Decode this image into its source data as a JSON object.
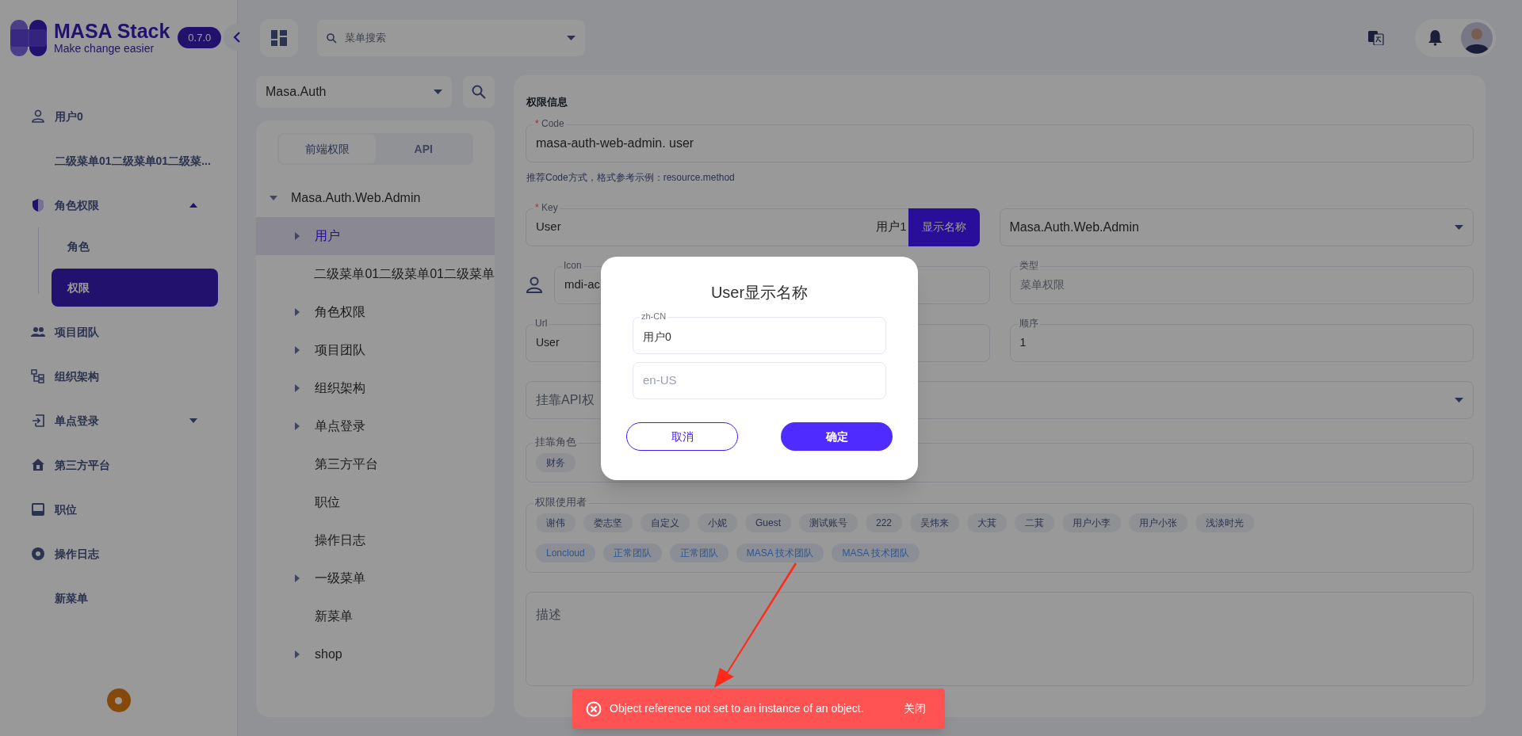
{
  "app": {
    "title": "MASA Stack",
    "subtitle": "Make change easier",
    "version": "0.7.0"
  },
  "sidebar": {
    "items": [
      {
        "label": "用户0",
        "kind": "link",
        "selected": false
      },
      {
        "label": "二级菜单01二级菜单01二级菜...",
        "kind": "link",
        "selected": false
      },
      {
        "label": "角色权限",
        "kind": "group",
        "expanded": true,
        "selected": false,
        "children": [
          {
            "label": "角色",
            "selected": false
          },
          {
            "label": "权限",
            "selected": true
          }
        ]
      },
      {
        "label": "项目团队",
        "kind": "link",
        "selected": false
      },
      {
        "label": "组织架构",
        "kind": "link",
        "selected": false
      },
      {
        "label": "单点登录",
        "kind": "group",
        "expanded": false,
        "selected": false
      },
      {
        "label": "第三方平台",
        "kind": "link",
        "selected": false
      },
      {
        "label": "职位",
        "kind": "link",
        "selected": false
      },
      {
        "label": "操作日志",
        "kind": "link",
        "selected": false
      },
      {
        "label": "新菜单",
        "kind": "link",
        "selected": false
      }
    ]
  },
  "header": {
    "search_placeholder": "菜单搜索"
  },
  "tree": {
    "app_select": "Masa.Auth",
    "tabs": [
      {
        "label": "前端权限",
        "selected": true
      },
      {
        "label": "API",
        "selected": false
      }
    ],
    "items": [
      {
        "label": "Masa.Auth.Web.Admin",
        "kind": "branch",
        "expanded": true,
        "selected": false,
        "children": [
          {
            "label": "用户",
            "kind": "branch",
            "expanded": false,
            "selected": true
          },
          {
            "label": "二级菜单01二级菜单01二级菜单",
            "kind": "leaf",
            "selected": false
          },
          {
            "label": "角色权限",
            "kind": "branch",
            "expanded": false,
            "selected": false
          },
          {
            "label": "项目团队",
            "kind": "branch",
            "expanded": false,
            "selected": false
          },
          {
            "label": "组织架构",
            "kind": "branch",
            "expanded": false,
            "selected": false
          },
          {
            "label": "单点登录",
            "kind": "branch",
            "expanded": false,
            "selected": false
          },
          {
            "label": "第三方平台",
            "kind": "leaf",
            "selected": false
          },
          {
            "label": "职位",
            "kind": "leaf",
            "selected": false
          },
          {
            "label": "操作日志",
            "kind": "leaf",
            "selected": false
          },
          {
            "label": "一级菜单",
            "kind": "branch",
            "expanded": false,
            "selected": false
          },
          {
            "label": "新菜单",
            "kind": "leaf",
            "selected": false
          },
          {
            "label": "shop",
            "kind": "branch",
            "expanded": false,
            "selected": false
          }
        ]
      }
    ]
  },
  "form": {
    "title": "权限信息",
    "code": {
      "required_mark": "*",
      "label": "Code",
      "value": "masa-auth-web-admin. user"
    },
    "code_hint": "推荐Code方式，格式参考示例：resource.method",
    "key": {
      "required_mark": "*",
      "label": "Key",
      "value": "User",
      "display_name": "用户1",
      "button": "显示名称"
    },
    "app_select": {
      "value": "Masa.Auth.Web.Admin"
    },
    "icon": {
      "label": "Icon",
      "value": "mdi-ac"
    },
    "type": {
      "label": "类型",
      "value": "菜单权限"
    },
    "url": {
      "label": "Url",
      "value": "User"
    },
    "order": {
      "label": "顺序",
      "value": "1"
    },
    "api_select": {
      "placeholder": "挂靠API权"
    },
    "roles": {
      "label": "挂靠角色",
      "chips": [
        {
          "label": "财务"
        }
      ]
    },
    "users": {
      "label": "权限使用者",
      "chips": [
        {
          "label": "谢伟",
          "kind": "user"
        },
        {
          "label": "娄志坚",
          "kind": "user"
        },
        {
          "label": "自定义",
          "kind": "user"
        },
        {
          "label": "小妮",
          "kind": "user"
        },
        {
          "label": "Guest",
          "kind": "user"
        },
        {
          "label": "测试账号",
          "kind": "user"
        },
        {
          "label": "222",
          "kind": "user"
        },
        {
          "label": "吴炜来",
          "kind": "user"
        },
        {
          "label": "大萁",
          "kind": "user"
        },
        {
          "label": "二萁",
          "kind": "user"
        },
        {
          "label": "用户小李",
          "kind": "user"
        },
        {
          "label": "用户小张",
          "kind": "user"
        },
        {
          "label": "浅淡时光",
          "kind": "user"
        },
        {
          "label": "Loncloud",
          "kind": "team"
        },
        {
          "label": "正常团队",
          "kind": "team"
        },
        {
          "label": "正常团队",
          "kind": "team"
        },
        {
          "label": "MASA 技术团队",
          "kind": "team"
        },
        {
          "label": "MASA 技术团队",
          "kind": "team"
        }
      ]
    },
    "description": {
      "placeholder": "描述"
    }
  },
  "modal": {
    "title": "User显示名称",
    "fields": [
      {
        "label": "zh-CN",
        "value": "用户0"
      },
      {
        "placeholder": "en-US"
      }
    ],
    "cancel": "取消",
    "confirm": "确定"
  },
  "snackbar": {
    "message": "Object reference not set to an instance of an object.",
    "action": "关闭"
  }
}
